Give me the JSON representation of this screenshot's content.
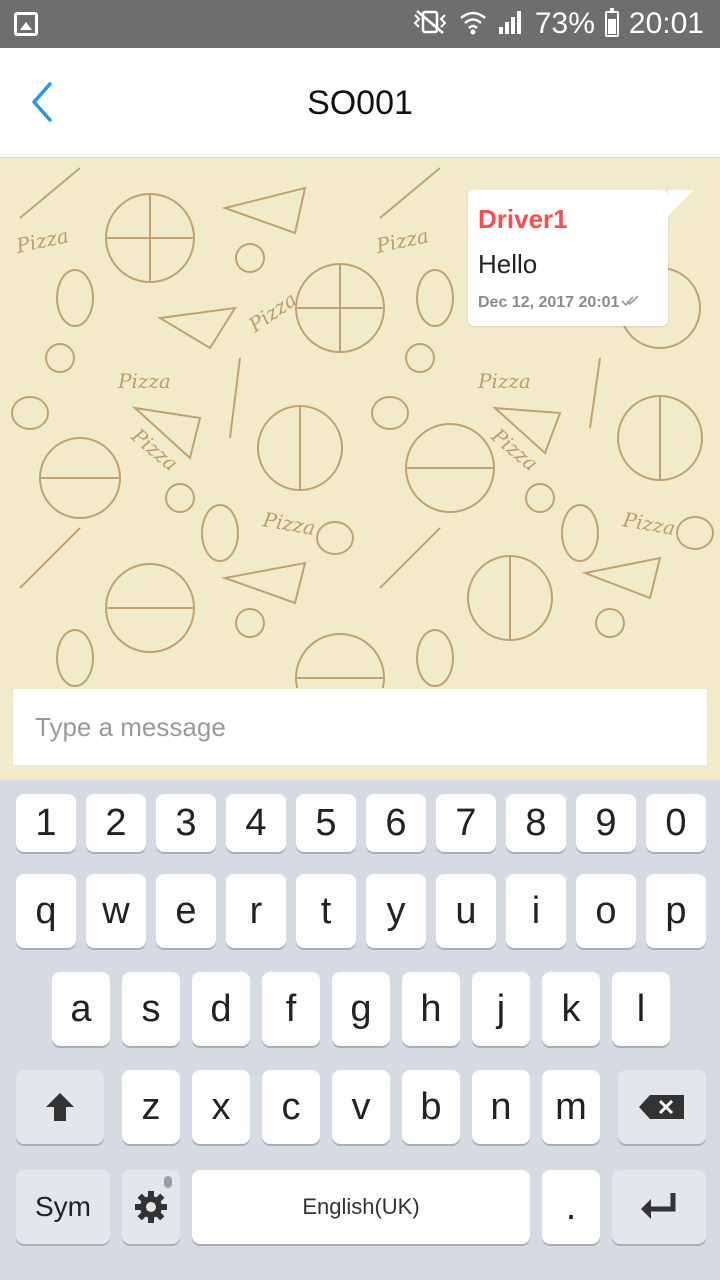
{
  "status_bar": {
    "battery_percent": "73%",
    "time": "20:01",
    "icons": [
      "image-notification-icon",
      "mute-vibrate-icon",
      "wifi-icon",
      "signal-icon",
      "battery-icon"
    ]
  },
  "app_bar": {
    "title": "SO001",
    "back_icon": "chevron-left-icon",
    "accent_color": "#2196f3"
  },
  "chat": {
    "background_color": "#f1ebcb",
    "pattern_color": "#b08a55",
    "messages": [
      {
        "sender": "Driver1",
        "sender_color": "#ff4b4b",
        "text": "Hello",
        "timestamp": "Dec 12, 2017 20:01",
        "status_icon": "double-check-icon"
      }
    ],
    "pattern_words": [
      "Pizza",
      "Pizza",
      "Pizza",
      "Pizza",
      "Pizza",
      "Pizza",
      "Pizza",
      "Pizza",
      "Pizza"
    ]
  },
  "compose": {
    "placeholder": "Type a message",
    "value": ""
  },
  "keyboard": {
    "row_numbers": [
      "1",
      "2",
      "3",
      "4",
      "5",
      "6",
      "7",
      "8",
      "9",
      "0"
    ],
    "row_top": [
      "q",
      "w",
      "e",
      "r",
      "t",
      "y",
      "u",
      "i",
      "o",
      "p"
    ],
    "row_middle": [
      "a",
      "s",
      "d",
      "f",
      "g",
      "h",
      "j",
      "k",
      "l"
    ],
    "row_bottom": [
      "z",
      "x",
      "c",
      "v",
      "b",
      "n",
      "m"
    ],
    "sym_label": "Sym",
    "space_label": "English(UK)",
    "period_label": ".",
    "icons": {
      "shift": "shift-arrow-icon",
      "backspace": "backspace-icon",
      "settings": "gear-icon",
      "enter": "enter-icon"
    }
  }
}
